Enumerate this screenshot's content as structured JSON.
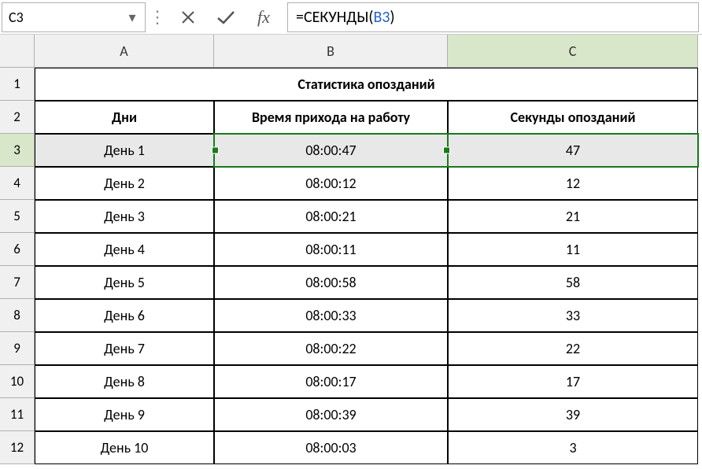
{
  "namebox": "C3",
  "formula": {
    "prefix": "=СЕКУНДЫ(",
    "ref": "B3",
    "suffix": ")"
  },
  "icons": {
    "dropdown": "▾",
    "dots": "⋮",
    "cancel": "✕",
    "enter": "✓",
    "fx": "fx"
  },
  "columns": [
    "A",
    "B",
    "C"
  ],
  "title": "Статистика опозданий",
  "headers": {
    "A": "Дни",
    "B": "Время прихода на работу",
    "C": "Секунды опозданий"
  },
  "rows": [
    {
      "n": 3,
      "A": "День 1",
      "B": "08:00:47",
      "C": "47"
    },
    {
      "n": 4,
      "A": "День 2",
      "B": "08:00:12",
      "C": "12"
    },
    {
      "n": 5,
      "A": "День 3",
      "B": "08:00:21",
      "C": "21"
    },
    {
      "n": 6,
      "A": "День 4",
      "B": "08:00:11",
      "C": "11"
    },
    {
      "n": 7,
      "A": "День 5",
      "B": "08:00:58",
      "C": "58"
    },
    {
      "n": 8,
      "A": "День 6",
      "B": "08:00:33",
      "C": "33"
    },
    {
      "n": 9,
      "A": "День 7",
      "B": "08:00:22",
      "C": "22"
    },
    {
      "n": 10,
      "A": "День 8",
      "B": "08:00:17",
      "C": "17"
    },
    {
      "n": 11,
      "A": "День 9",
      "B": "08:00:39",
      "C": "39"
    },
    {
      "n": 12,
      "A": "День 10",
      "B": "08:00:03",
      "C": "3"
    }
  ]
}
